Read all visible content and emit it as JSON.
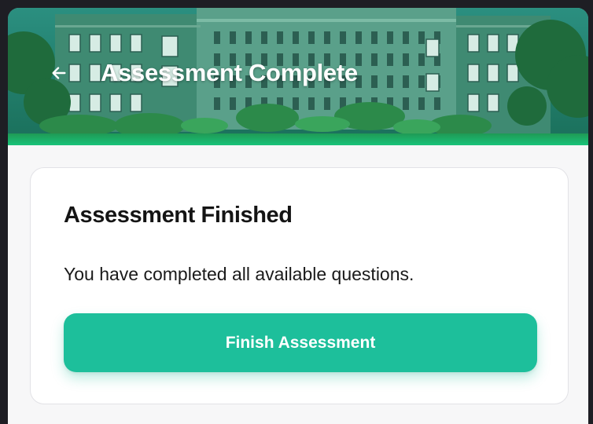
{
  "header": {
    "title": "Assessment Complete",
    "back_icon": "arrow-left-icon",
    "background_image": "campus-building-photo"
  },
  "card": {
    "title": "Assessment Finished",
    "message": "You have completed all available questions.",
    "finish_button_label": "Finish Assessment"
  },
  "colors": {
    "accent": "#1dbf9b",
    "header_tint": "#1d7a62",
    "card_background": "#ffffff",
    "page_background": "#f7f7f8",
    "outer_background": "#1e1e24"
  }
}
